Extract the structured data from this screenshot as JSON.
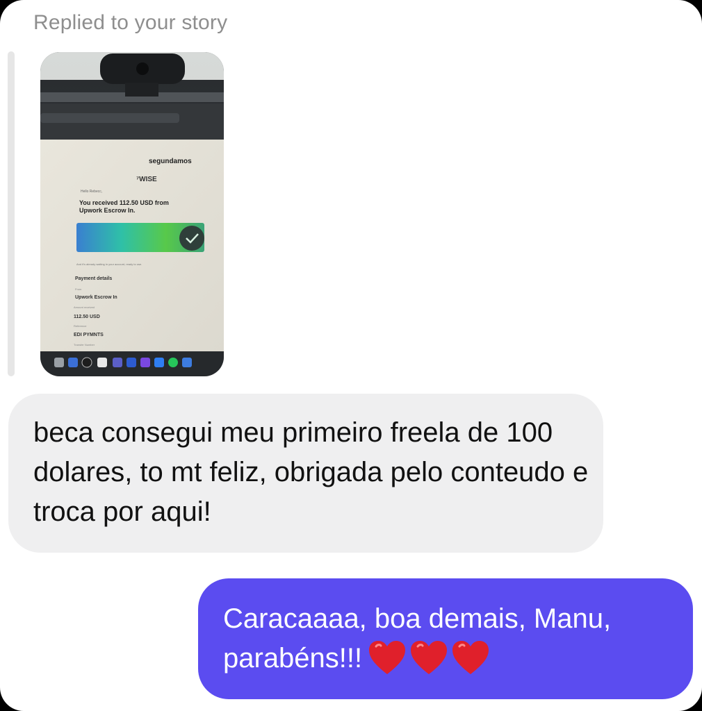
{
  "reply_context": {
    "label": "Replied to your story"
  },
  "story": {
    "email": {
      "sender": "segundamos",
      "brand": "⁷WISE",
      "greeting": "Hello Rebecc,",
      "headline": "You received 112.50 USD from Upwork Escrow In.",
      "note": "And it's already waiting in your account, ready to use.",
      "details_title": "Payment details",
      "from_label": "From",
      "from_value": "Upwork Escrow In",
      "amount_label": "Amount received",
      "amount_value": "112.50 USD",
      "reference_label": "Reference",
      "reference_value": "EDI PYMNTS",
      "transfer_label": "Transfer Number"
    }
  },
  "messages": {
    "incoming": {
      "text": "beca consegui meu primeiro freela de 100 dolares, to mt feliz, obrigada pelo conteudo e troca por aqui!"
    },
    "outgoing": {
      "text": "Caracaaaa, boa demais, Manu, parabéns!!!",
      "emoji": [
        "red-heart",
        "red-heart",
        "red-heart"
      ]
    }
  },
  "colors": {
    "incoming_bubble": "#efeff0",
    "outgoing_bubble": "#5b4cf0",
    "label_gray": "#8e8e8e",
    "heart": "#e0202b"
  }
}
